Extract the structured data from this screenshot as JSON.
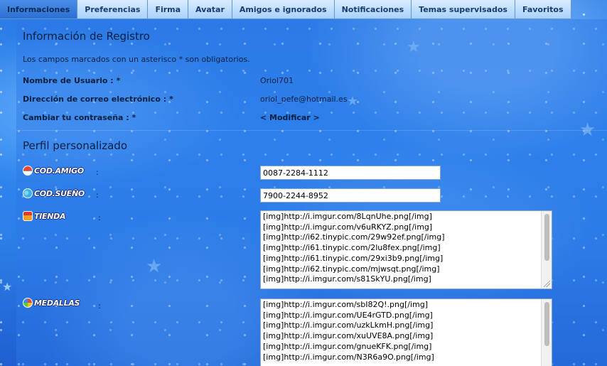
{
  "tabs": [
    {
      "label": "Informaciones",
      "active": true
    },
    {
      "label": "Preferencias"
    },
    {
      "label": "Firma"
    },
    {
      "label": "Avatar"
    },
    {
      "label": "Amigos e ignorados"
    },
    {
      "label": "Notificaciones"
    },
    {
      "label": "Temas supervisados"
    },
    {
      "label": "Favoritos"
    }
  ],
  "registro": {
    "title": "Información de Registro",
    "note": "Los campos marcados con un asterisco * son obligatorios.",
    "rows": [
      {
        "label": "Nombre de Usuario : *",
        "value": "Oriol701"
      },
      {
        "label": "Dirección de correo electrónico : *",
        "value": "oriol_pefe@hotmail.es"
      },
      {
        "label": "Cambiar tu contraseña : *",
        "value": "< Modificar >"
      }
    ]
  },
  "perfil": {
    "title": "Perfil personalizado",
    "colon": ":",
    "fields": [
      {
        "badge": "COD.AMIGO",
        "icon": "pokeball-icon",
        "color": "#e8453c",
        "value": "0087-2284-1112"
      },
      {
        "badge": "COD.SUEÑO",
        "icon": "butterfly-icon",
        "color": "#3ab0e8",
        "value": "7900-2244-8952"
      }
    ],
    "tienda": {
      "badge": "TIENDA",
      "icon": "shop-icon",
      "color": "#f0a020",
      "lines": [
        "[img]http://i.imgur.com/8LqnUhe.png[/img]",
        "[img]http://i.imgur.com/v6uRKYZ.png[/img]",
        "[img]http://i62.tinypic.com/29w92ef.png[/img]",
        "[img]http://i61.tinypic.com/2lu8fex.png[/img]",
        "[img]http://i61.tinypic.com/29xi3b9.png[/img]",
        "[img]http://i62.tinypic.com/mjwsqt.png[/img]",
        "[img]http://i.imgur.com/s81SkYU.png[/img]"
      ]
    },
    "medallas": {
      "badge": "MEDALLAS",
      "icon": "medal-icon",
      "color": "#5cc83a",
      "lines": [
        "[img]http://i.imgur.com/sbI82Q!.png[/img]",
        "[img]http://i.imgur.com/UE4rGTD.png[/img]",
        "[img]http://i.imgur.com/uzkLkmH.png[/img]",
        "[img]http://i.imgur.com/xuUVE8A.png[/img]",
        "[img]http://i.imgur.com/gnueKFK.png[/img]",
        "[img]http://i.imgur.com/N3R6a9O.png[/img]"
      ]
    }
  }
}
